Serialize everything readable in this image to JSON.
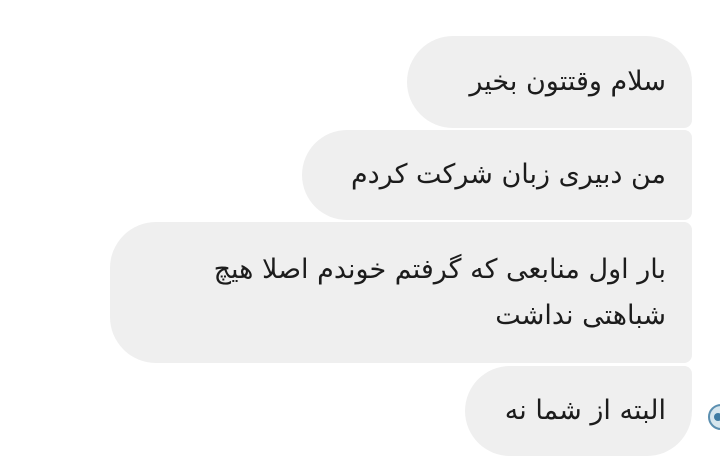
{
  "messages": [
    {
      "text": "سلام وقتتون بخیر"
    },
    {
      "text": "من دبیری زبان شرکت کردم"
    },
    {
      "text": "بار اول منابعی که گرفتم خوندم اصلا هیچ شباهتی نداشت"
    },
    {
      "text": "البته از شما نه"
    }
  ],
  "avatar": {
    "icon": "user-avatar-icon"
  }
}
